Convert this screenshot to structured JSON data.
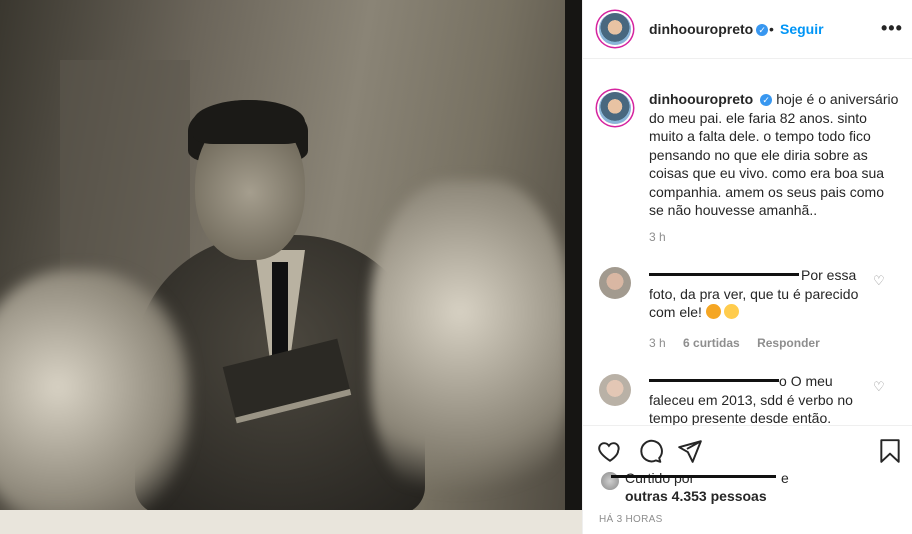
{
  "post": {
    "username": "dinhoouropreto",
    "follow_label": "Seguir",
    "more_label": "•••",
    "separator": "•"
  },
  "caption": {
    "username": "dinhoouropreto",
    "text": "hoje é o aniversário do meu pai. ele faria 82 anos. sinto muito a falta dele. o tempo todo fico pensando no que ele diria sobre as coisas que eu vivo. como era boa sua companhia. amem os seus pais como se não houvesse amanhã..",
    "time": "3 h"
  },
  "comments": [
    {
      "text": "Por essa foto, da pra ver, que tu é parecido com ele!",
      "time": "3 h",
      "likes": "6 curtidas",
      "reply_label": "Responder"
    },
    {
      "username_partial": "o",
      "text": "O meu faleceu em 2013, sdd é verbo no tempo presente desde então."
    }
  ],
  "likes": {
    "prefix_partial": "Curtido por",
    "suffix_partial": "e",
    "others": "outras 4.353 pessoas"
  },
  "timestamp": "HÁ 3 HORAS",
  "icons": [
    "heart-icon",
    "comment-icon",
    "share-icon",
    "save-icon",
    "verified-icon",
    "more-icon"
  ],
  "colors": {
    "accent": "#0095f6",
    "verified": "#3897f0",
    "muted": "#8e8e8e",
    "text": "#262626"
  }
}
